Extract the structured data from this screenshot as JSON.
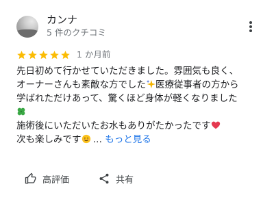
{
  "reviewer": {
    "name": "カンナ",
    "meta": "5 件のクチコミ",
    "avatar_icon": "profile-photo"
  },
  "rating": {
    "stars": 5,
    "max": 5,
    "star_color": "#fbbc04",
    "time": "1 か月前"
  },
  "review": {
    "lines": [
      "先日初めて行かせていただきました。雰囲気も良く、",
      "オーナーさんも素敵な方でした",
      "医療従事者の方から",
      "学ばれただけあって、驚くほど身体が軽くなりました",
      "施術後にいただいたお水もありがたかったです",
      "次も楽しみです",
      "…",
      "もっと見る"
    ],
    "emojis": [
      "sparkles-emoji",
      "four-leaf-clover-emoji",
      "heart-emoji",
      "smiling-face-emoji"
    ]
  },
  "actions": {
    "like_label": "高評価",
    "share_label": "共有"
  },
  "colors": {
    "link": "#1a73e8",
    "secondary_text": "#70757a"
  }
}
